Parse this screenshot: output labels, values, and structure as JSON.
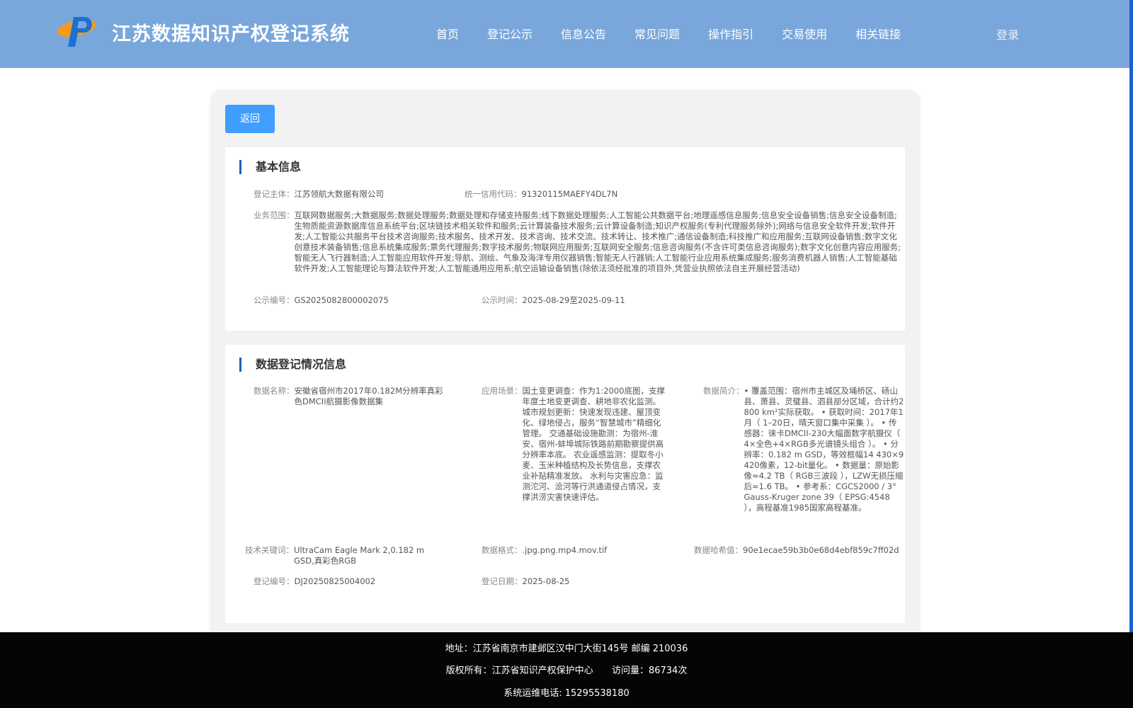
{
  "header": {
    "title": "江苏数据知识产权登记系统",
    "nav": [
      "首页",
      "登记公示",
      "信息公告",
      "常见问题",
      "操作指引",
      "交易使用",
      "相关链接"
    ],
    "login": "登录"
  },
  "back_label": "返回",
  "basic": {
    "section_title": "基本信息",
    "subject_label": "登记主体：",
    "subject": "江苏领航大数据有限公司",
    "credit_label": "统一信用代码：",
    "credit": "91320115MAEFY4DL7N",
    "scope_label": "业务范围：",
    "scope": "互联网数据服务;大数据服务;数据处理服务;数据处理和存储支持服务;线下数据处理服务;人工智能公共数据平台;地理遥感信息服务;信息安全设备销售;信息安全设备制造;生物质能资源数据库信息系统平台;区块链技术相关软件和服务;云计算装备技术服务;云计算设备制造;知识产权服务(专利代理服务除外);网络与信息安全软件开发;软件开发;人工智能公共服务平台技术咨询服务;技术服务、技术开发、技术咨询、技术交流、技术转让、技术推广;通信设备制造;科技推广和应用服务;互联网设备销售;数字文化创意技术装备销售;信息系统集成服务;票务代理服务;数字技术服务;物联网应用服务;互联网安全服务;信息咨询服务(不含许可类信息咨询服务);数字文化创意内容应用服务;智能无人飞行器制造;人工智能应用软件开发;导航、测绘、气象及海洋专用仪器销售;智能无人行器销;人工智能行业应用系统集成服务;服务消费机器人销售;人工智能基础软件开发;人工智能理论与算法软件开发;人工智能通用应用系;航空运输设备销售(除依法须经批准的项目外,凭营业执照依法自主开展经营活动)",
    "notice_no_label": "公示编号：",
    "notice_no": "GS2025082800002075",
    "notice_time_label": "公示时间：",
    "notice_time": "2025-08-29至2025-09-11"
  },
  "registration": {
    "section_title": "数据登记情况信息",
    "name_label": "数据名称：",
    "name": "安徽省宿州市2017年0.182M分辨率真彩色DMCII航摄影像数据集",
    "scene_label": "应用场景：",
    "scene": "国土变更调查：作为1:2000底图，支撑年度土地变更调查、耕地非农化监测。 城市规划更新：快速发现违建、屋顶变化、绿地侵占，服务“智慧城市”精细化管理。 交通基础设施勘测：为宿州-淮安、宿州-蚌埠城际铁路前期勘察提供高分辨率本底。 农业遥感监测：提取冬小麦、玉米种植结构及长势信息，支撑农业补贴精准发放。 水利与灾害应急：监测沱河、浍河等行洪通道侵占情况，支撑洪涝灾害快速评估。",
    "intro_label": "数据简介：",
    "intro": "• 覆盖范围：宿州市主城区及埇桥区、砀山县、萧县、灵璧县、泗县部分区域，合计约2 800 km²实际获取。 • 获取时间：2017年1月（ 1–20日，晴天窗口集中采集 ）。 • 传感器：徕卡DMCII-230大幅面数字航摄仪（ 4×全色+4×RGB多光谱镜头组合 ）。 • 分辨率：0.182 m GSD，等效框幅14 430×9 420像素，12-bit量化。 • 数据量：原始影像≈4.2 TB（ RGB三波段 ），LZW无损压缩后≈1.6 TB。 • 参考系：CGCS2000 / 3° Gauss-Kruger zone 39（ EPSG:4548 ），高程基准1985国家高程基准。",
    "keywords_label": "技术关键词：",
    "keywords": "UltraCam Eagle Mark 2,0.182 m GSD,真彩色RGB",
    "format_label": "数据格式：",
    "format": ".jpg.png.mp4.mov.tif",
    "hash_label": "数据哈希值：",
    "hash": "90e1ecae59b3b0e68d4ebf859c7ff02d",
    "reg_no_label": "登记编号：",
    "reg_no": "DJ20250825004002",
    "reg_date_label": "登记日期：",
    "reg_date": "2025-08-25"
  },
  "footer": {
    "address": "地址：江苏省南京市建邺区汉中门大街145号 邮编 210036",
    "copyright": "版权所有：江苏省知识产权保护中心",
    "visits": "访问量：86734次",
    "phone": "系统运维电话: 15295538180"
  },
  "colors": {
    "header": "#79a7dc",
    "button": "#409eff",
    "accent_bar": "#1f5fb6",
    "footer": "#050505"
  },
  "icons": {
    "logo": "p-logo-icon"
  }
}
